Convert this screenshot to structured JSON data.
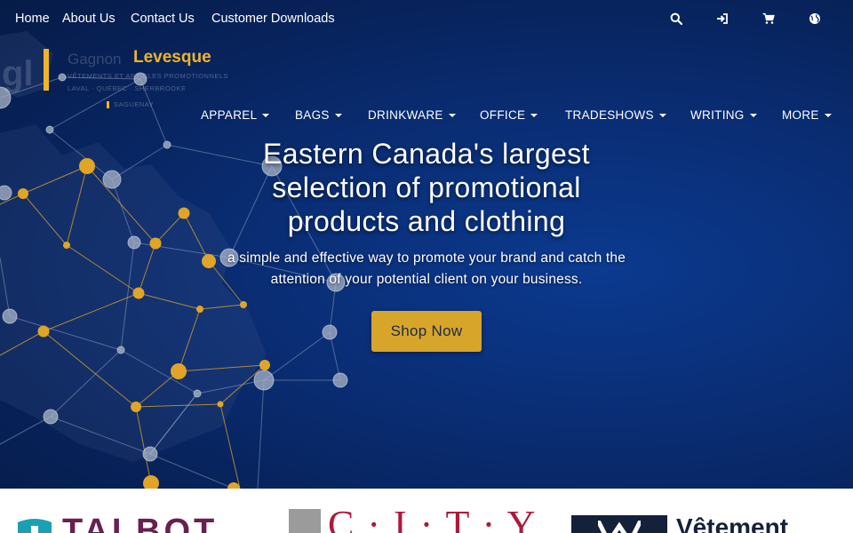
{
  "topbar": {
    "links": [
      "Home",
      "About Us",
      "Contact Us",
      "Customer Downloads"
    ],
    "icons": [
      "search-icon",
      "sign-in-icon",
      "cart-icon",
      "globe-icon"
    ]
  },
  "logo": {
    "word": "Levesque",
    "faint_word": "Gagnon",
    "tagline_1": "VÊTEMENTS ET ARTICLES PROMOTIONNELS",
    "tagline_2": "LAVAL · QUÉBEC · SHERBROOKE",
    "tagline_3": "SAGUENAY"
  },
  "nav": {
    "items": [
      "APPAREL",
      "BAGS",
      "DRINKWARE",
      "OFFICE",
      "TRADESHOWS",
      "WRITING",
      "MORE"
    ]
  },
  "hero": {
    "headline_1": "Eastern Canada's largest",
    "headline_2": "selection of promotional",
    "headline_3": "products and clothing",
    "subline_1": "a simple and effective way to promote your brand and catch the",
    "subline_2": "attention of your potential client on your business.",
    "cta": "Shop Now"
  },
  "partners": {
    "items": [
      "TALBOT",
      "C · I · T · Y",
      "Vêtement"
    ]
  },
  "colors": {
    "accent_gold": "#d7a52a",
    "hero_blue": "#0a2f78",
    "node_gold": "#e0a526",
    "node_gray": "#9aa4b6"
  }
}
